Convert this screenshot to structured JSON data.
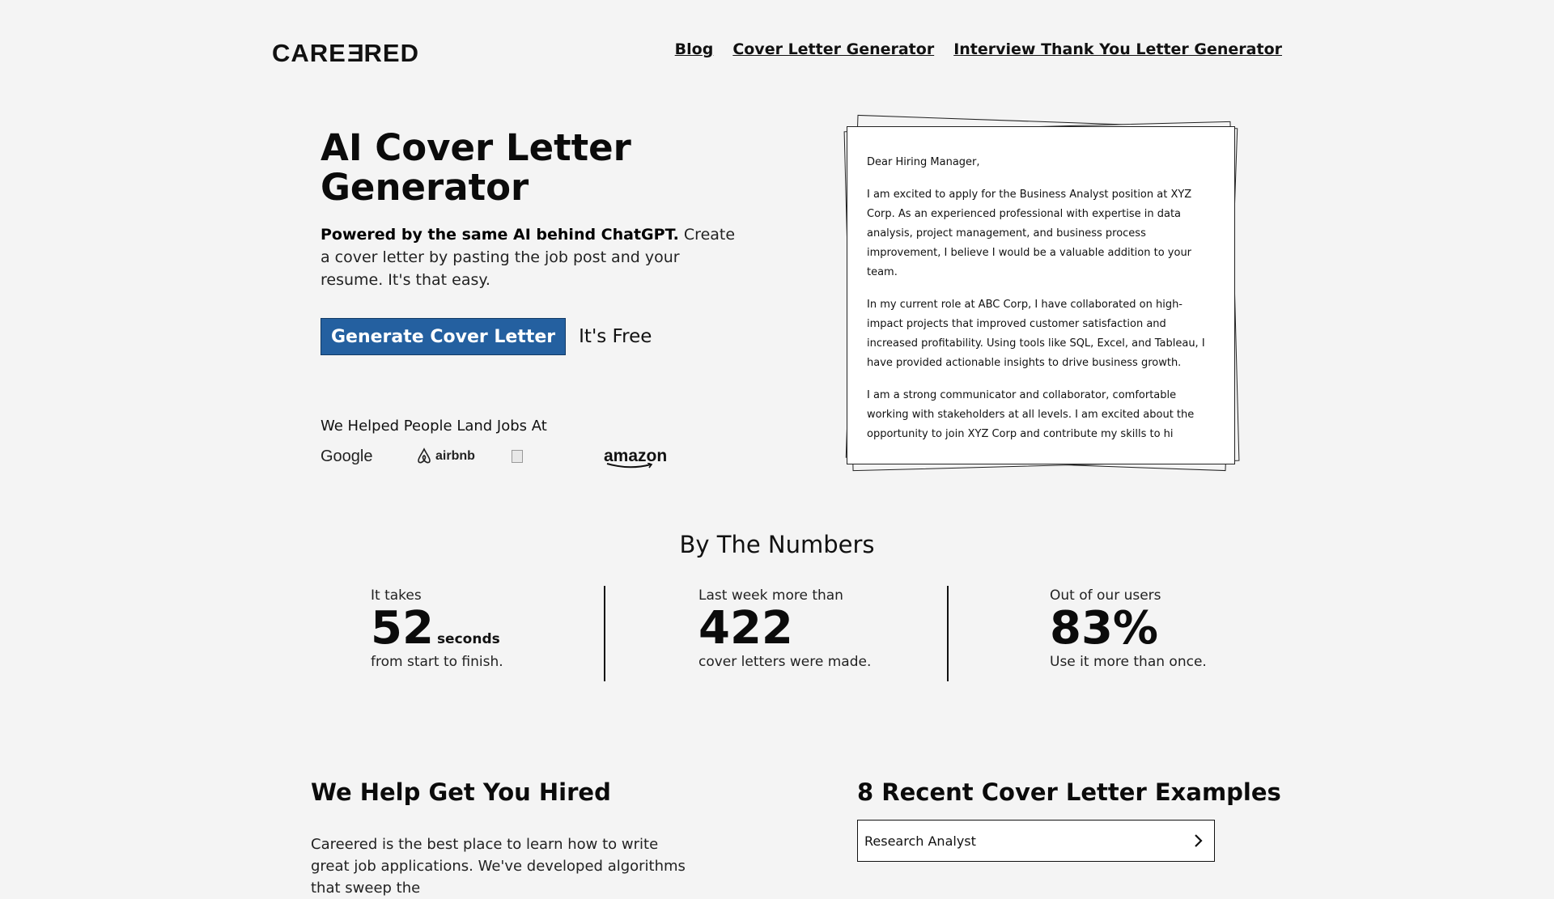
{
  "header": {
    "logo": {
      "prefix": "CARE",
      "flipped": "E",
      "suffix": "RED"
    },
    "nav": [
      "Blog",
      "Cover Letter Generator",
      "Interview Thank You Letter Generator"
    ]
  },
  "hero": {
    "title": "AI Cover Letter Generator",
    "desc_bold": "Powered by the same AI behind ChatGPT.",
    "desc_rest": " Create a cover letter by pasting the job post and your resume. It's that easy.",
    "cta_label": "Generate Cover Letter",
    "cta_note": "It's Free",
    "helped_label": "We Helped People Land Jobs At",
    "companies": {
      "google": "Google",
      "airbnb": "airbnb",
      "amazon": "amazon"
    }
  },
  "letter": {
    "greeting": "Dear Hiring Manager,",
    "p1": "I am excited to apply for the Business Analyst position at XYZ Corp. As an experienced professional with expertise in data analysis, project management, and business process improvement, I believe I would be a valuable addition to your team.",
    "p2": "In my current role at ABC Corp, I have collaborated on high-impact projects that improved customer satisfaction and increased profitability. Using tools like SQL, Excel, and Tableau, I have provided actionable insights to drive business growth.",
    "p3": "I am a strong communicator and collaborator, comfortable working with stakeholders at all levels. I am excited about the opportunity to join XYZ Corp and contribute my skills to hi"
  },
  "numbers": {
    "title": "By The Numbers",
    "stats": [
      {
        "pre": "It takes",
        "value": "52",
        "unit": "seconds",
        "post": "from start to finish."
      },
      {
        "pre": "Last week more than",
        "value": "422",
        "unit": "",
        "post": "cover letters were made."
      },
      {
        "pre": "Out of our users",
        "value": "83%",
        "unit": "",
        "post": "Use it more than once."
      }
    ]
  },
  "help": {
    "title": "We Help Get You Hired",
    "text": "Careered is the best place to learn how to write great job applications. We've developed algorithms that sweep the"
  },
  "examples": {
    "title": "8 Recent Cover Letter Examples",
    "items": [
      "Research Analyst"
    ]
  }
}
